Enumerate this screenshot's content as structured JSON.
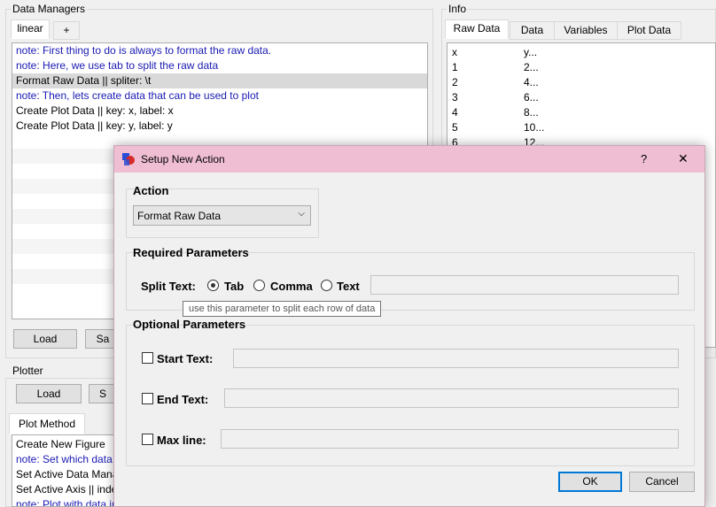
{
  "data_managers": {
    "title": "Data Managers",
    "tabs": [
      "linear",
      "+"
    ],
    "rows": [
      {
        "text": "note: First thing to do is always to format the raw data.",
        "note": true
      },
      {
        "text": "note: Here, we use tab to split the raw data",
        "note": true
      },
      {
        "text": "Format Raw Data || spliter: \\t",
        "note": false,
        "selected": true
      },
      {
        "text": "note: Then, lets create data that can be used to plot",
        "note": true
      },
      {
        "text": "Create Plot Data || key: x, label: x",
        "note": false
      },
      {
        "text": "Create Plot Data || key: y, label: y",
        "note": false
      }
    ],
    "load_label": "Load",
    "save_label": "Sa"
  },
  "info": {
    "title": "Info",
    "tabs": [
      "Raw Data",
      "Data",
      "Variables",
      "Plot Data"
    ],
    "rows": [
      [
        "x",
        "y..."
      ],
      [
        "1",
        "2..."
      ],
      [
        "2",
        "4..."
      ],
      [
        "3",
        "6..."
      ],
      [
        "4",
        "8..."
      ],
      [
        "5",
        "10..."
      ],
      [
        "6",
        "12..."
      ]
    ]
  },
  "plotter": {
    "title": "Plotter",
    "load_label": "Load",
    "save_label": "S",
    "tab": "Plot Method",
    "rows": [
      {
        "text": "Create New Figure",
        "note": false
      },
      {
        "text": "note: Set which data",
        "note": true
      },
      {
        "text": "Set Active Data Mana",
        "note": false
      },
      {
        "text": "Set Active Axis || inde",
        "note": false
      },
      {
        "text": "note: Plot with data in active data manager with corresponding label",
        "note": true
      }
    ]
  },
  "dialog": {
    "title": "Setup New Action",
    "help": "?",
    "close": "✕",
    "action_label": "Action",
    "action_value": "Format Raw Data",
    "required_label": "Required Parameters",
    "split_label": "Split Text:",
    "opt_tab": "Tab",
    "opt_comma": "Comma",
    "opt_text": "Text",
    "tooltip": "use this parameter to split each row of data",
    "optional_label": "Optional Parameters",
    "start_label": "Start Text:",
    "end_label": "End Text:",
    "max_label": "Max line:",
    "ok": "OK",
    "cancel": "Cancel"
  }
}
